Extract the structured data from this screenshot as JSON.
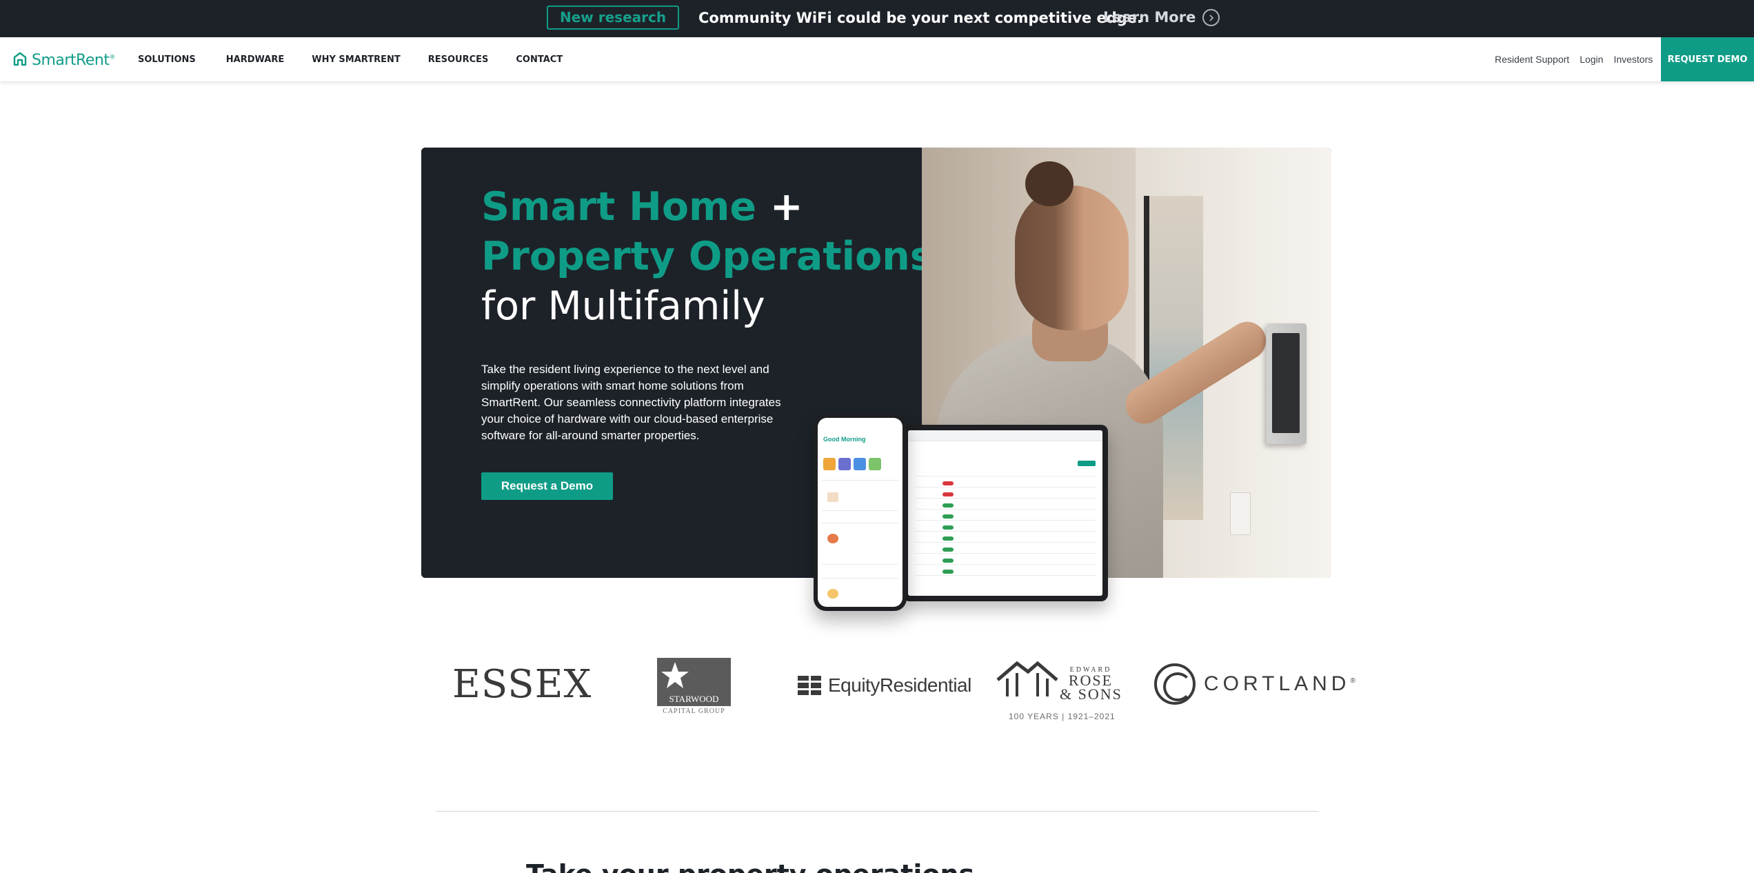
{
  "announcement": {
    "badge": "New research",
    "message": "Community WiFi could be your next competitive edge.",
    "link_label": "Learn More"
  },
  "nav": {
    "brand": "SmartRent",
    "brand_mark": "®",
    "links": [
      "SOLUTIONS",
      "HARDWARE",
      "WHY SMARTRENT",
      "RESOURCES",
      "CONTACT"
    ],
    "utility_links": [
      "Resident Support",
      "Login",
      "Investors"
    ],
    "cta_label": "REQUEST DEMO"
  },
  "hero": {
    "title_line1_accent": "Smart Home",
    "title_line1_plus": " +",
    "title_line2_accent": "Property Operations",
    "title_line3": "for Multifamily",
    "description": "Take the resident living experience to the next level and simplify operations with smart home solutions from SmartRent. Our seamless connectivity platform integrates your choice of hardware with our cloud-based enterprise software for all-around smarter properties.",
    "cta_label": "Request a Demo",
    "phone_greeting": "Good Morning"
  },
  "logos": {
    "essex": "ESSEX",
    "starwood": "STARWOOD",
    "starwood_sub": "CAPITAL GROUP",
    "equity": "EquityResidential",
    "rose_top": "EDWARD",
    "rose_mid": "ROSE",
    "rose_bottom": "& SONS",
    "rose_years": "100 YEARS | 1921–2021",
    "cortland": "CORTLAND",
    "cortland_mark": "®"
  },
  "next_section": {
    "heading": "Take your property operations"
  },
  "colors": {
    "accent": "#0f9c87",
    "dark": "#1d2229",
    "white": "#ffffff"
  }
}
